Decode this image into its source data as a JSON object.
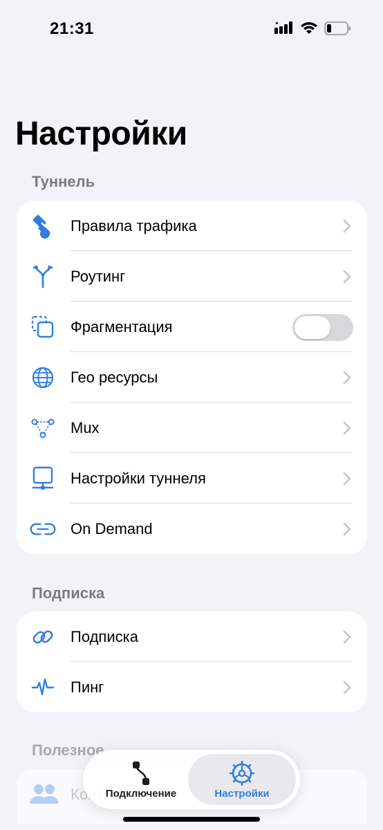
{
  "status_bar": {
    "time": "21:31"
  },
  "page_title": "Настройки",
  "sections": {
    "tunnel": {
      "header": "Туннель",
      "items": [
        {
          "label": "Правила трафика",
          "icon": "traffic-rules-icon"
        },
        {
          "label": "Роутинг",
          "icon": "routing-icon"
        },
        {
          "label": "Фрагментация",
          "icon": "fragmentation-icon",
          "toggle": false
        },
        {
          "label": "Гео ресурсы",
          "icon": "globe-icon"
        },
        {
          "label": "Mux",
          "icon": "mux-icon"
        },
        {
          "label": "Настройки туннеля",
          "icon": "tunnel-settings-icon"
        },
        {
          "label": "On Demand",
          "icon": "link-icon"
        }
      ]
    },
    "subscription": {
      "header": "Подписка",
      "items": [
        {
          "label": "Подписка",
          "icon": "chain-link-icon"
        },
        {
          "label": "Пинг",
          "icon": "pulse-icon"
        }
      ]
    },
    "useful": {
      "header": "Полезное",
      "items": [
        {
          "label": "Контакты",
          "icon": "people-icon"
        }
      ]
    }
  },
  "tabbar": {
    "connect_label": "Подключение",
    "settings_label": "Настройки",
    "active_tab": "settings"
  },
  "colors": {
    "accent": "#2f7de1",
    "background": "#f2f2f7",
    "card": "#ffffff",
    "section_header": "#7a7a80"
  }
}
